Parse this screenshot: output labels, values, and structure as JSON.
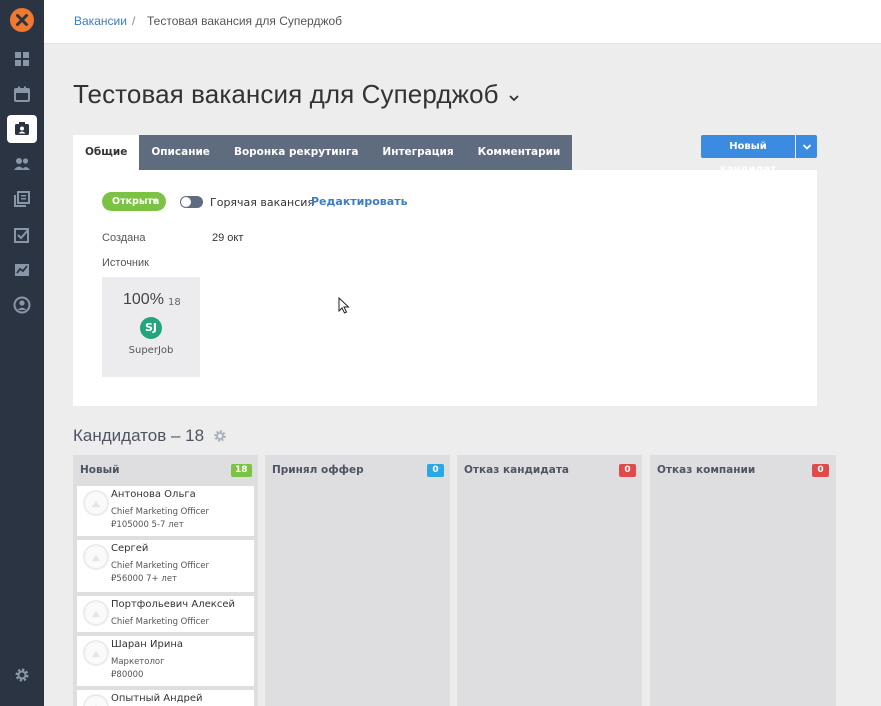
{
  "sidebar": {
    "items": [
      {
        "icon": "dashboard-icon"
      },
      {
        "icon": "calendar-icon"
      },
      {
        "icon": "vacancies-icon",
        "active": true
      },
      {
        "icon": "candidates-icon"
      },
      {
        "icon": "database-icon"
      },
      {
        "icon": "tasks-icon"
      },
      {
        "icon": "analytics-icon"
      },
      {
        "icon": "profile-icon"
      }
    ],
    "settings_icon": "gear-icon"
  },
  "breadcrumb": {
    "link": "Вакансии",
    "separator": "/",
    "current": "Тестовая вакансия для Суперджоб"
  },
  "page": {
    "title": "Тестовая вакансия для Суперджоб"
  },
  "tabs": [
    {
      "label": "Общие",
      "active": true
    },
    {
      "label": "Описание"
    },
    {
      "label": "Воронка рекрутинга"
    },
    {
      "label": "Интеграция"
    },
    {
      "label": "Комментарии"
    }
  ],
  "new_candidate_button": "Новый кандидат",
  "general": {
    "status": "Открыта",
    "hot_label": "Горячая вакансия",
    "hot_enabled": false,
    "edit_link": "Редактировать",
    "created_label": "Создана",
    "created_value": "29 окт",
    "source_label": "Источник",
    "source": {
      "percent": "100%",
      "count": "18",
      "badge": "SJ",
      "name": "SuperJob"
    }
  },
  "candidates": {
    "title": "Кандидатов – 18",
    "columns": [
      {
        "title": "Новый",
        "count": "18",
        "color": "#7cc243",
        "cards": [
          {
            "name": "Антонова Ольга",
            "position": "Chief Marketing Officer",
            "details": "₽105000  5-7 лет"
          },
          {
            "name": "Сергей",
            "position": "Chief Marketing Officer",
            "details": "₽56000  7+ лет"
          },
          {
            "name": "Портфольевич Алексей",
            "position": "Chief Marketing Officer"
          },
          {
            "name": "Шаран Ирина",
            "position": "Маркетолог",
            "details": "₽80000"
          },
          {
            "name": "Опытный Андрей"
          }
        ]
      },
      {
        "title": "Принял оффер",
        "count": "0",
        "color": "#2ba6e6"
      },
      {
        "title": "Отказ кандидата",
        "count": "0",
        "color": "#e04a4a"
      },
      {
        "title": "Отказ компании",
        "count": "0",
        "color": "#e04a4a"
      }
    ]
  },
  "colors": {
    "sidebar": "#2b3443",
    "accent": "#3b8be0",
    "open_status": "#7cc243",
    "tab_inactive": "#5f6b7e",
    "logo": "#f0782f",
    "sj_badge": "#23a47c"
  }
}
